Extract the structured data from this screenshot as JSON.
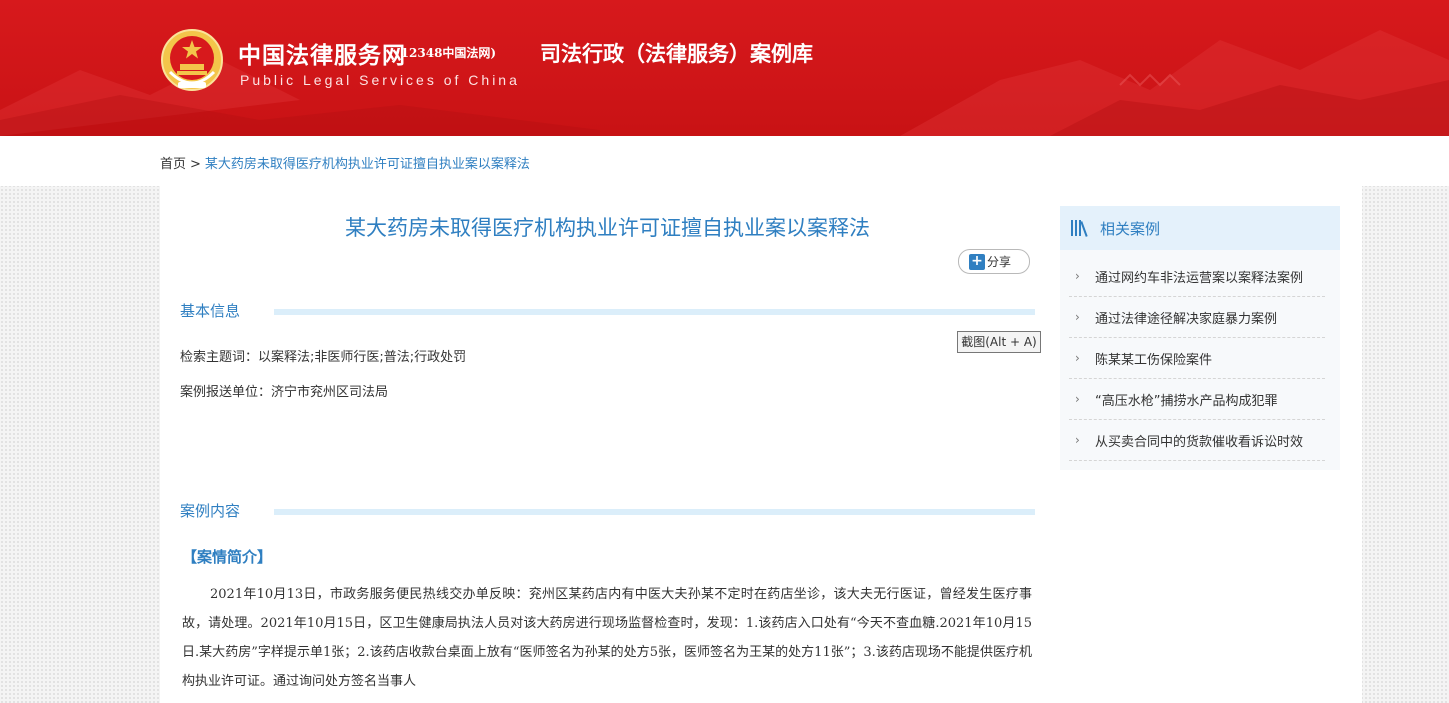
{
  "header": {
    "site_name": "中国法律服务网",
    "site_sub": "(12348中国法网)",
    "site_en": "Public Legal Services of China",
    "section_title": "司法行政（法律服务）案例库",
    "brand_color": "#d7191c",
    "emblem_icon": "national-emblem-icon"
  },
  "breadcrumb": {
    "home": "首页",
    "separator": ">",
    "current": "某大药房未取得医疗机构执业许可证擅自执业案以案释法"
  },
  "article": {
    "title": "某大药房未取得医疗机构执业许可证擅自执业案以案释法",
    "share_label": "分享",
    "screenshot_tip": "截图(Alt + A)",
    "basic_info_title": "基本信息",
    "keywords": "检索主题词：以案释法;非医师行医;普法;行政处罚",
    "reporting_unit": "案例报送单位：济宁市兖州区司法局",
    "case_content_title": "案例内容",
    "case_subhead": "【案情简介】",
    "case_paragraph": "2021年10月13日，市政务服务便民热线交办单反映：兖州区某药店内有中医大夫孙某不定时在药店坐诊，该大夫无行医证，曾经发生医疗事故，请处理。2021年10月15日，区卫生健康局执法人员对该大药房进行现场监督检查时，发现：1.该药店入口处有“今天不查血糖.2021年10月15日.某大药房”字样提示单1张；2.该药店收款台桌面上放有“医师签名为孙某的处方5张，医师签名为王某的处方11张”；3.该药店现场不能提供医疗机构执业许可证。通过询问处方签名当事人",
    "accent_color": "#2f7fc1"
  },
  "related": {
    "title": "相关案例",
    "items": [
      "通过网约车非法运营案以案释法案例",
      "通过法律途径解决家庭暴力案例",
      "陈某某工伤保险案件",
      "“高压水枪”捕捞水产品构成犯罪",
      "从买卖合同中的货款催收看诉讼时效"
    ]
  }
}
